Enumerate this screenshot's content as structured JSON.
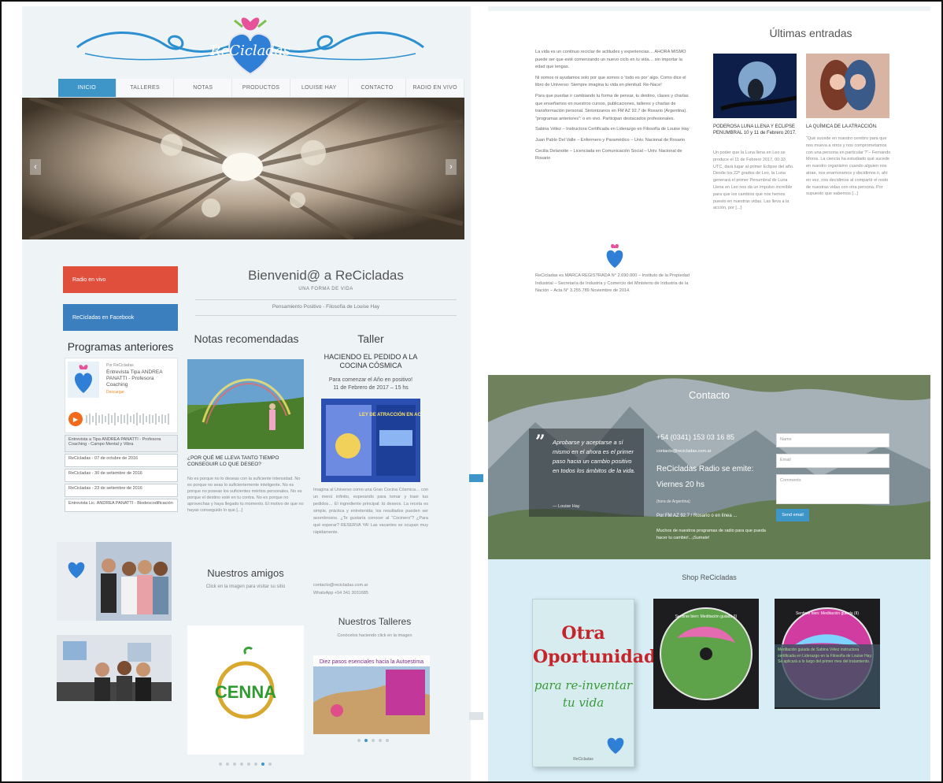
{
  "left_page": {
    "logo_text": "ReCicladas",
    "nav": [
      "INICIO",
      "TALLERES",
      "NOTAS",
      "PRODUCTOS",
      "LOUISE HAY",
      "CONTACTO",
      "RADIO EN VIVO"
    ],
    "slider_prev": "‹",
    "slider_next": "›",
    "sidebar": {
      "radio_btn": "Radio en vivo",
      "facebook_btn": "ReCicladas en Facebook",
      "programs_title": "Programas anteriores",
      "player": {
        "by": "Por ReCicladas",
        "title": "Entrevista Tipa ANDREA PANATTI - Profesora Coaching",
        "follow": "Descargar",
        "tracks": [
          "Entrevista a Tipa ANDREA PANATTI - Profesora Coaching - Campo Mental y Vibra",
          "ReCicladas - 07 de octubre de 2016",
          "ReCicladas - 30 de setiembre de 2016",
          "ReCicladas - 23 de setiembre de 2016",
          "Entrevista Lic. ANDREA PANATTI - Biodescodificación"
        ]
      }
    },
    "welcome": {
      "title": "Bienvenid@ a ReCicladas",
      "subtitle": "UNA FORMA DE VIDA",
      "tagline": "Pensamiento Positivo - Filosofía de Louise Hay"
    },
    "notas": {
      "heading": "Notas recomendadas",
      "title": "¿POR QUÉ ME LLEVA TANTO TIEMPO CONSEGUIR LO QUE DESEO?",
      "text": "No es porque no lo deseas con la suficiente intensidad. No es porque no seas lo suficientemente inteligente. No es porque no poseas los suficientes méritos personales. No es porque el destino esté en tu contra. No es porque no aprovechas y haya llegado tu momento. El motivo de que no hayas conseguido lo que [...]"
    },
    "taller": {
      "heading": "Taller",
      "title": "HACIENDO EL PEDIDO A LA COCINA CÓSMICA",
      "sub1": "Para comenzar el Año en positivo!",
      "sub2": "11 de Febrero de 2017 – 15 hs",
      "flyer_heading": "LEY DE ATRACCIÓN EN ACCIÓN",
      "text": "Imagina al Universo como una Gran Cocina Cósmica… con un menú infinito, esperando para tomar y traer tus pedidos… El ingrediente principal: tú deseos. La receta es simple, práctica y entretenida; los resultados pueden ser asombrosos. ¿Te gustaría conocer al “Cocinero”? ¿Para qué esperar? RESERVA YA! Las vacantes se ocupan muy rápidamente.",
      "contact": "contacto@recicladas.com.ar",
      "whatsapp": "WhatsApp +54 341 3031685"
    },
    "amigos": {
      "heading": "Nuestros amigos",
      "sub": "Click en la imagen para visitar su sitio",
      "logo": "CENNA"
    },
    "talleres": {
      "heading": "Nuestros Talleres",
      "sub": "Conócelos haciendo click en la imagen",
      "banner": "Diez pasos esenciales hacia la Autoestima"
    }
  },
  "right_page": {
    "ultimas_title": "Últimas entradas",
    "about": [
      "La vida es un continuo reciclar de actitudes y experiencias… AHORA MISMO puede ser que esté comenzando un nuevo ciclo en tu vida… sin importar la edad que tengas.",
      "Ni somos ni ayudamos solo por que somos o ‘todo es por’ algo. Como dice el libro de Universo: Siempre imagina tu vida en plenitud. Re-Nace!",
      "Para que puedas ir cambiando tu forma de pensar, tu destino, clases y charlas que enseñamos en nuestros cursos, publicaciones, talleres y charlas de transformación personal. Sintonizanos en FM AZ 92.7 de Rosario (Argentina). “programas anteriores”: o en vivo. Participan destacados profesionales.",
      "Sabina Vélez – Instructora Certificada en Liderazgo en Filosofía de Louise Hay",
      "Juan Pablo Del Valle – Enfermero y Paramédico – Univ. Nacional de Rosario",
      "Cecilia Delanotte – Licenciada en Comunicación Social – Univ. Nacional de Rosario"
    ],
    "about_registered": "ReCicladas es MARCA REGISTRADA N° 2.690.000 – Instituto de la Propiedad Industrial – Secretaría de Industria y Comercio del Ministerio de Industria de la Nación – Acta N° 3.255.789 Noviembre de 2014.",
    "posts": [
      {
        "title": "PODEROSA LUNA LLENA Y ECLIPSE PENUMBRAL 10 y 11 de Febrero 2017.",
        "text": "Un poder que la Luna llena en Leo se produce el 11 de Febrero 2017, 00:33 UTC, dará lugar al primer Eclipse del año. Desde los 22º grados de Leo, la Luna generará el primer Penumbral de Luna Llena en Leo nos da un impulso increíble para que los cambios que nos hemos puesto en nuestras vidas. Las lleva a la acción, por [...]"
      },
      {
        "title": "LA QUÍMICA DE LA ATRACCIÓN.",
        "text": "“Qué sucede en nuestro cerebro para que nos mueva a otros y nos comprometamos con una persona en particular ?”– Fernando Moros. La ciencia ha estudiado qué sucede en nuestro organismo cuando alguien nos atrae, nos enamoramos y decidimos ir, ahí en vez, nos decidimos al compartir el resto de nuestras vidas con otra persona. Por supuesto que sabemos [...]"
      }
    ],
    "contact": {
      "heading": "Contacto",
      "quote": "Aprobarse y aceptarse a sí mismo en el ahora es el primer paso hacia un cambio positivo en todos los ámbitos de la vida.",
      "quote_author": "— Louise Hay",
      "phone": "+54 (0341) 153 03 16 85",
      "email": "contacto@recicladas.com.ar",
      "radio_line1": "ReCicladas Radio se emite:",
      "radio_line2": "Viernes 20 hs",
      "radio_country": "(hora de Argentina)",
      "radio_fm": "Por FM AZ 92.7 / Rosario o en línea ...",
      "radio_more": "Muchos de nuestros programas de radio para que pueda hacer tu cambio!...¡Sumate!",
      "field_name": "Name",
      "field_email": "Email",
      "field_comments": "Comments",
      "send": "Send email"
    },
    "shop": {
      "heading": "Shop ReCicladas",
      "book_title": "Otra Oportunidad",
      "book_sub": "para re-inventar tu vida",
      "book_footer": "ReCicladas",
      "cd1_title": "Sentirse bien: Meditación guiada (I)",
      "cd2_title": "Sentirse bien: Meditación guiada (II)",
      "cd_overlay": "Meditación guiada de Sabina Vélez instructora certificada en Liderazgo en la Filosofía de Louise Hay. Se aplicará a lo largo del primer mes del tratamiento."
    }
  },
  "colors": {
    "accent": "#3e95c8",
    "red": "#e04e3c",
    "fb_blue": "#3b7fbf"
  }
}
